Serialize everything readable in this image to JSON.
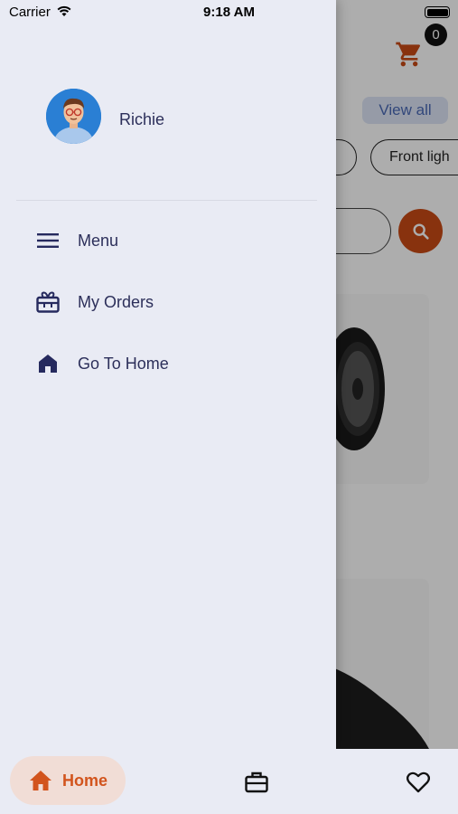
{
  "status_bar": {
    "carrier": "Carrier",
    "time": "9:18 AM"
  },
  "background": {
    "cart_count": "0",
    "view_all": "View all",
    "chips": [
      "",
      "Front ligh"
    ]
  },
  "drawer": {
    "user_name": "Richie",
    "items": [
      {
        "label": "Menu",
        "icon": "menu-icon"
      },
      {
        "label": "My Orders",
        "icon": "gift-box-icon"
      },
      {
        "label": "Go To Home",
        "icon": "home-icon"
      }
    ]
  },
  "tabbar": {
    "home_label": "Home",
    "active": "home",
    "colors": {
      "accent": "#d2541d",
      "active_bg": "#f1ddd6",
      "text": "#2c2f5a"
    }
  }
}
